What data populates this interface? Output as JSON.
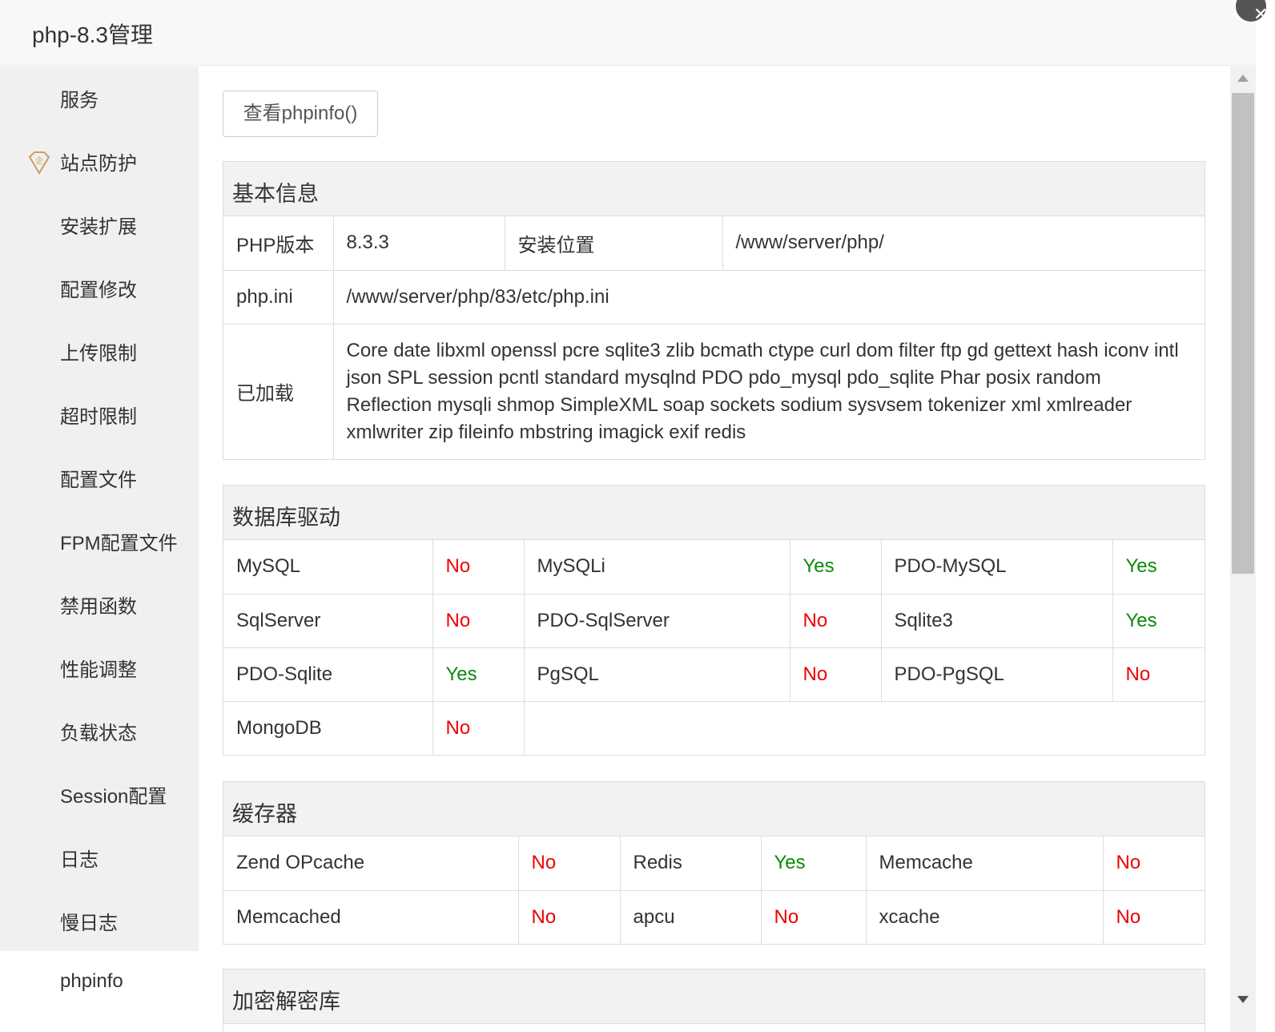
{
  "window": {
    "title": "php-8.3管理"
  },
  "sidebar": {
    "items": [
      {
        "label": "服务"
      },
      {
        "label": "站点防护",
        "icon": "enterprise-diamond-icon",
        "icon_text": "企"
      },
      {
        "label": "安装扩展"
      },
      {
        "label": "配置修改"
      },
      {
        "label": "上传限制"
      },
      {
        "label": "超时限制"
      },
      {
        "label": "配置文件"
      },
      {
        "label": "FPM配置文件"
      },
      {
        "label": "禁用函数"
      },
      {
        "label": "性能调整"
      },
      {
        "label": "负载状态"
      },
      {
        "label": "Session配置"
      },
      {
        "label": "日志"
      },
      {
        "label": "慢日志"
      },
      {
        "label": "phpinfo",
        "active": true
      }
    ]
  },
  "main": {
    "phpinfo_button": "查看phpinfo()",
    "basic": {
      "title": "基本信息",
      "php_version_label": "PHP版本",
      "php_version": "8.3.3",
      "install_path_label": "安装位置",
      "install_path": "/www/server/php/",
      "ini_label": "php.ini",
      "ini_path": "/www/server/php/83/etc/php.ini",
      "loaded_label": "已加载",
      "loaded": "Core date libxml openssl pcre sqlite3 zlib bcmath ctype curl dom filter ftp gd gettext hash iconv intl json SPL session pcntl standard mysqlnd PDO pdo_mysql pdo_sqlite Phar posix random Reflection mysqli shmop SimpleXML soap sockets sodium sysvsem tokenizer xml xmlreader xmlwriter zip fileinfo mbstring imagick exif redis"
    },
    "db": {
      "title": "数据库驱动",
      "rows": [
        [
          {
            "name": "MySQL",
            "value": "No"
          },
          {
            "name": "MySQLi",
            "value": "Yes"
          },
          {
            "name": "PDO-MySQL",
            "value": "Yes"
          }
        ],
        [
          {
            "name": "SqlServer",
            "value": "No"
          },
          {
            "name": "PDO-SqlServer",
            "value": "No"
          },
          {
            "name": "Sqlite3",
            "value": "Yes"
          }
        ],
        [
          {
            "name": "PDO-Sqlite",
            "value": "Yes"
          },
          {
            "name": "PgSQL",
            "value": "No"
          },
          {
            "name": "PDO-PgSQL",
            "value": "No"
          }
        ],
        [
          {
            "name": "MongoDB",
            "value": "No"
          }
        ]
      ]
    },
    "cache": {
      "title": "缓存器",
      "rows": [
        [
          {
            "name": "Zend OPcache",
            "value": "No"
          },
          {
            "name": "Redis",
            "value": "Yes"
          },
          {
            "name": "Memcache",
            "value": "No"
          }
        ],
        [
          {
            "name": "Memcached",
            "value": "No"
          },
          {
            "name": "apcu",
            "value": "No"
          },
          {
            "name": "xcache",
            "value": "No"
          }
        ]
      ]
    },
    "crypto": {
      "title": "加密解密库"
    }
  },
  "colors": {
    "yes": "#0a8a0a",
    "no": "#ee0000"
  }
}
